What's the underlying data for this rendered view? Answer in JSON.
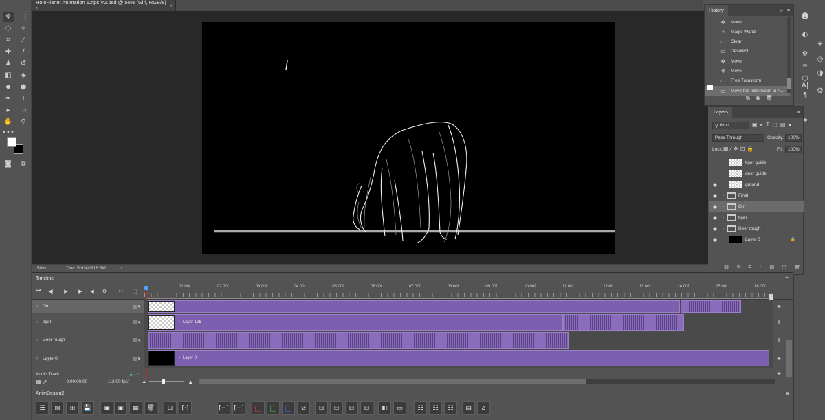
{
  "document": {
    "tab_title": "HoloPlanet Animation 12fps V2.psd @ 50% (Girl, RGB/8) *",
    "close_glyph": "×",
    "zoom": "50%",
    "doc_info": "Doc: 5.93M/818.8M",
    "status_arrow": "›"
  },
  "tools": [
    {
      "name": "move-tool-icon",
      "glyph": "✥"
    },
    {
      "name": "marquee-tool-icon",
      "glyph": "⬚"
    },
    {
      "name": "lasso-tool-icon",
      "glyph": "◌"
    },
    {
      "name": "magic-wand-icon",
      "glyph": "✧"
    },
    {
      "name": "crop-tool-icon",
      "glyph": "⌗"
    },
    {
      "name": "eyedropper-icon",
      "glyph": "⁄"
    },
    {
      "name": "healing-brush-icon",
      "glyph": "✚"
    },
    {
      "name": "brush-tool-icon",
      "glyph": "∕"
    },
    {
      "name": "stamp-tool-icon",
      "glyph": "♟"
    },
    {
      "name": "history-brush-icon",
      "glyph": "↺"
    },
    {
      "name": "eraser-tool-icon",
      "glyph": "◧"
    },
    {
      "name": "bucket-tool-icon",
      "glyph": "◈"
    },
    {
      "name": "blur-tool-icon",
      "glyph": "◆"
    },
    {
      "name": "dodge-tool-icon",
      "glyph": "●"
    },
    {
      "name": "pen-tool-icon",
      "glyph": "✒"
    },
    {
      "name": "type-tool-icon",
      "glyph": "T"
    },
    {
      "name": "path-select-icon",
      "glyph": "▸"
    },
    {
      "name": "shape-tool-icon",
      "glyph": "▭"
    },
    {
      "name": "hand-tool-icon",
      "glyph": "✋"
    },
    {
      "name": "zoom-tool-icon",
      "glyph": "⚲"
    },
    {
      "name": "more-tools-icon",
      "glyph": "•••"
    }
  ],
  "history": {
    "title": "History",
    "menu_glyph": "≡",
    "expand_glyph": "»",
    "items": [
      {
        "label": "Move",
        "icon": "✥"
      },
      {
        "label": "Magic Wand",
        "icon": "✧"
      },
      {
        "label": "Clear",
        "icon": "▭"
      },
      {
        "label": "Deselect",
        "icon": "▭"
      },
      {
        "label": "Move",
        "icon": "✥"
      },
      {
        "label": "Move",
        "icon": "✥"
      },
      {
        "label": "Free Transform",
        "icon": "▭"
      },
      {
        "label": "Move the InBetween in N...",
        "icon": "▭"
      }
    ],
    "footer_icons": [
      "⧉",
      "◉",
      "🗑"
    ]
  },
  "layers": {
    "title": "Layers",
    "menu_glyph": "≡",
    "filter_label": "Kind",
    "blend_mode": "Pass Through",
    "opacity_label": "Opacity:",
    "opacity_value": "100%",
    "lock_label": "Lock:",
    "fill_label": "Fill:",
    "fill_value": "100%",
    "items": [
      {
        "name": "tiger guide",
        "visible": false,
        "type": "layer"
      },
      {
        "name": "deer guide",
        "visible": false,
        "type": "layer"
      },
      {
        "name": "ground",
        "visible": true,
        "type": "layer"
      },
      {
        "name": "Final",
        "visible": true,
        "type": "group"
      },
      {
        "name": "Girl",
        "visible": true,
        "type": "group"
      },
      {
        "name": "tiger",
        "visible": true,
        "type": "group"
      },
      {
        "name": "Deer rough",
        "visible": true,
        "type": "group"
      },
      {
        "name": "Layer 0",
        "visible": true,
        "type": "black"
      }
    ],
    "eye_glyph": "◉",
    "lock_glyph": "🔒",
    "footer_icons": [
      "⛓",
      "fx",
      "◘",
      "◐",
      "▤",
      "▢",
      "🗑"
    ]
  },
  "timeline": {
    "title": "Timeline",
    "menu_glyph": "≡",
    "ticks": [
      "01:00f",
      "02:00f",
      "03:00f",
      "04:00f",
      "05:00f",
      "06:00f",
      "07:00f",
      "08:00f",
      "09:00f",
      "10:00f",
      "11:00f",
      "12:00f",
      "13:00f",
      "14:00f",
      "15:00f",
      "16:00f"
    ],
    "tracks": [
      {
        "name": "Girl",
        "clip_label": ""
      },
      {
        "name": "tiger",
        "clip_label": "Layer 126"
      },
      {
        "name": "Deer rough",
        "clip_label": ""
      },
      {
        "name": "Layer 0",
        "clip_label": "Layer 0"
      }
    ],
    "audio_track": "Audio Track",
    "timecode": "0:00:00:00",
    "fps": "(12.00 fps)",
    "controls": [
      "⏮",
      "◀|",
      "▶",
      "|▶",
      "◀",
      "⚙",
      "✂",
      "⬚"
    ]
  },
  "panel_bottom": {
    "title": "AnimDessin2",
    "menu_glyph": "≡",
    "buttons": [
      "☰",
      "▧",
      "⊞",
      "💾",
      "▣",
      "▣",
      "▦",
      "🗑",
      "⊡",
      "[·]",
      "[−]",
      "[+]",
      "□",
      "□",
      "□",
      "⊘",
      "⊟",
      "⊟",
      "⊟",
      "⊟",
      "◧",
      "▭",
      "☷",
      "☷",
      "☷",
      "▤",
      "⌂"
    ],
    "button_colors": {
      "red": "#e23b3b",
      "green": "#3bc14a",
      "blue": "#3b6ee2"
    }
  },
  "right_strip_icons": [
    "⓿",
    "◐",
    "⚙",
    "≡",
    "☀",
    "◎",
    "◑",
    "❂",
    "⬡",
    "A|",
    "¶",
    "◈"
  ]
}
